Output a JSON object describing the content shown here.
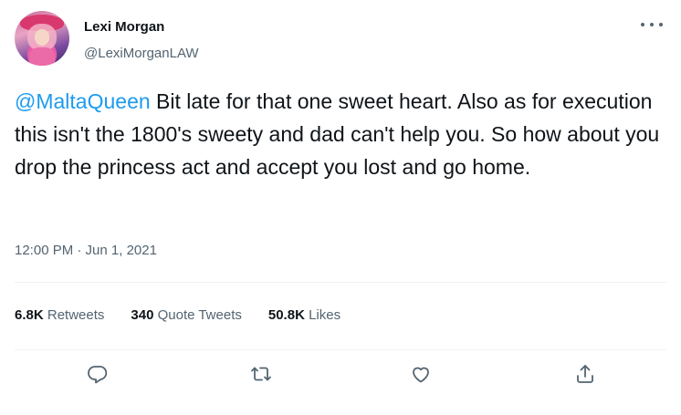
{
  "author": {
    "display_name": "Lexi Morgan",
    "handle": "@LexiMorganLAW"
  },
  "tweet": {
    "mention": "@MaltaQueen",
    "text": " Bit late for that one sweet heart. Also as for execution this isn't the 1800's sweety and dad can't help you. So how about you drop the princess act and accept you lost and go home.",
    "timestamp": "12:00 PM · Jun 1, 2021"
  },
  "stats": {
    "retweets_count": "6.8K",
    "retweets_label": "Retweets",
    "quotes_count": "340",
    "quotes_label": "Quote Tweets",
    "likes_count": "50.8K",
    "likes_label": "Likes"
  },
  "actions": {
    "reply_icon": "reply-icon",
    "retweet_icon": "retweet-icon",
    "like_icon": "like-icon",
    "share_icon": "share-icon"
  },
  "colors": {
    "accent": "#1d9bf0",
    "secondary_text": "#536471",
    "primary_text": "#0f1419",
    "divider": "#eff3f4"
  }
}
